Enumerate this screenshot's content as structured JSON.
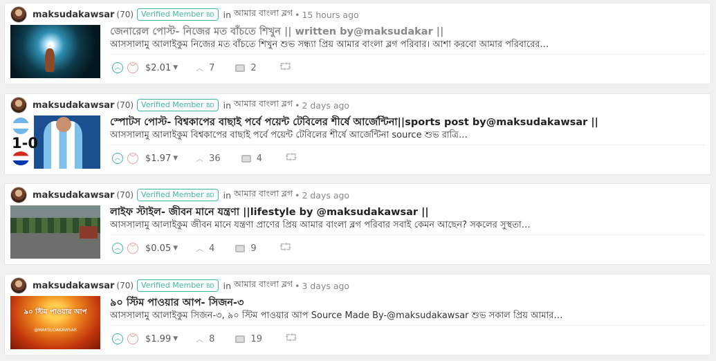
{
  "posts": [
    {
      "author": "maksudakawsar",
      "reputation": "(70)",
      "badge": "Verified Member",
      "badge_suffix": "BD",
      "in_word": "in",
      "community": "আমার বাংলা ব্লগ",
      "time": "15 hours ago",
      "title": "জেনারেল পোস্ট- নিজের মত বাঁচতে শিখুন || written by@maksudakar ||",
      "excerpt": "আসসালামু আলাইকুম নিজের মত বাঁচতে শিখুন শুভ সন্ধ্যা প্রিয় আমার বাংলা ব্লগ পরিবার। আশা করবো আমার পরিবারের…",
      "payout": "$2.01",
      "votes": "7",
      "replies": "2"
    },
    {
      "author": "maksudakawsar",
      "reputation": "(70)",
      "badge": "Verified Member",
      "badge_suffix": "BD",
      "in_word": "in",
      "community": "আমার বাংলা ব্লগ",
      "time": "2 days ago",
      "title": "স্পোটস পোস্ট-  বিশ্বকাপের বাছাই পর্বে পয়েন্ট টেবিলের শীর্ষে আর্জেন্টিনা||sports post by@maksudakawsar ||",
      "excerpt": "আসসালামু আলাইকুম বিশ্বকাপের বাছাই পর্বে পয়েন্ট টেবিলের শীর্ষে আর্জেন্টিনা source শুভ রাত্রি…",
      "payout": "$1.97",
      "votes": "36",
      "replies": "4"
    },
    {
      "author": "maksudakawsar",
      "reputation": "(70)",
      "badge": "Verified Member",
      "badge_suffix": "BD",
      "in_word": "in",
      "community": "আমার বাংলা ব্লগ",
      "time": "2 days ago",
      "title": "লাইফ স্টাইল- জীবন মানে যন্ত্রণা ||lifestyle by @maksudakawsar ||",
      "excerpt": "আসসালামু আলাইকুম জীবন মানে যন্ত্রণা প্রাণের প্রিয় আমার বাংলা ব্লগ পরিবার সবাই কেমন আছেন? সকলের সুস্থতা…",
      "payout": "$0.05",
      "votes": "4",
      "replies": "9"
    },
    {
      "author": "maksudakawsar",
      "reputation": "(70)",
      "badge": "Verified Member",
      "badge_suffix": "BD",
      "in_word": "in",
      "community": "আমার বাংলা ব্লগ",
      "time": "3 days ago",
      "title": "৯০ স্টিম পাওয়ার আপ- সিজন-৩",
      "excerpt": "আসসালামু আলাইকুম সিজন-৩, ৯০ স্টিম পাওয়ার আপ Source Made By-@maksudakawsar শুভ সকাল প্রিয় আমার…",
      "payout": "$1.99",
      "votes": "8",
      "replies": "19"
    }
  ],
  "thumbnails": {
    "post2_score": "1-0",
    "post4_title": "৯০ স্টিম পাওয়ার আপ",
    "post4_brand": "@MAKSUDAKAWSAR"
  },
  "icons": {
    "upvote": "chevron-up-icon",
    "downvote": "chevron-down-icon",
    "payout_menu": "caret-down-icon",
    "votes": "votes-icon",
    "replies": "comment-icon",
    "resteem": "resteem-icon"
  },
  "colors": {
    "accent": "#3fb6a4",
    "downvote": "#e08080",
    "background": "#f1f1f1"
  }
}
